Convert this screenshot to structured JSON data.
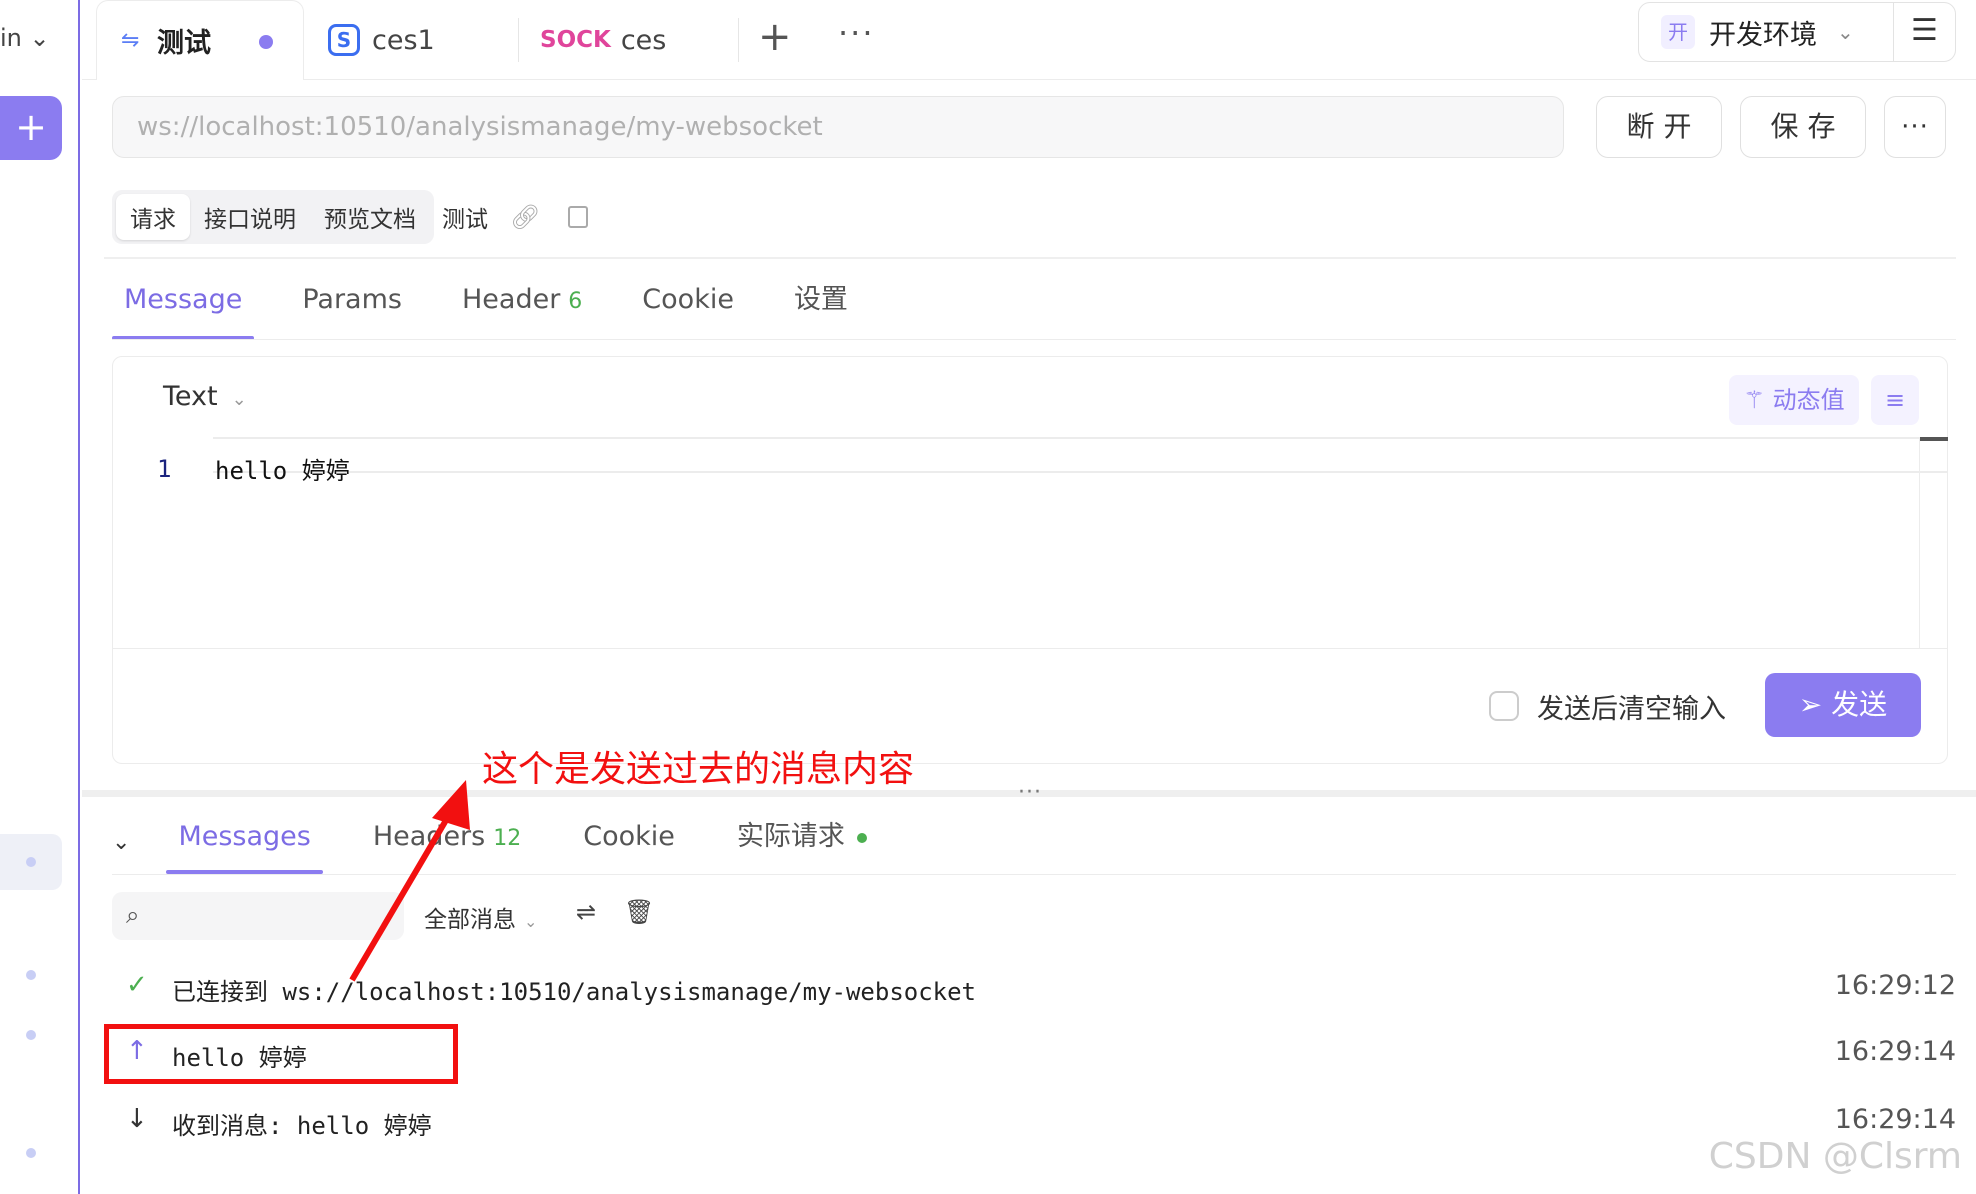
{
  "sidebar": {
    "workspace_label": "in ⌄",
    "add_label": "+"
  },
  "tabs": [
    {
      "label": "测试",
      "icon": "websocket-icon",
      "modified": true
    },
    {
      "label": "ces1",
      "icon": "socketio-icon"
    },
    {
      "label": "ces",
      "prefix": "SOCK"
    }
  ],
  "tab_add": "+",
  "tab_more": "···",
  "environment": {
    "badge": "开",
    "name": "开发环境",
    "menu_icon": "☰"
  },
  "request": {
    "url": "ws://localhost:10510/analysismanage/my-websocket",
    "disconnect_label": "断 开",
    "save_label": "保 存",
    "more_label": "···"
  },
  "doc_tabs": [
    "请求",
    "接口说明",
    "预览文档"
  ],
  "doc_tab_extra": "测试",
  "message_tabs": {
    "message": "Message",
    "params": "Params",
    "header": "Header",
    "header_count": "6",
    "cookie": "Cookie",
    "settings": "设置"
  },
  "editor": {
    "format": "Text",
    "dynamic_label": "动态值",
    "line_number": "1",
    "content": "hello 婷婷",
    "clear_after_send": "发送后清空输入",
    "send_label": "发送"
  },
  "annotation": "这个是发送过去的消息内容",
  "response_tabs": {
    "messages": "Messages",
    "headers": "Headers",
    "headers_count": "12",
    "cookie": "Cookie",
    "actual_request": "实际请求"
  },
  "filter": {
    "label": "全部消息"
  },
  "messages": [
    {
      "text": "已连接到 ws://localhost:10510/analysismanage/my-websocket",
      "time": "16:29:12",
      "icon": "✓"
    },
    {
      "text": "hello 婷婷",
      "time": "16:29:14",
      "icon": "↑"
    },
    {
      "text": "收到消息: hello 婷婷",
      "time": "16:29:14",
      "icon": "↓"
    }
  ],
  "watermark": "CSDN @Clsrm",
  "colors": {
    "accent": "#8b7cf0",
    "success": "#4caf50",
    "annotation": "#f21010"
  }
}
